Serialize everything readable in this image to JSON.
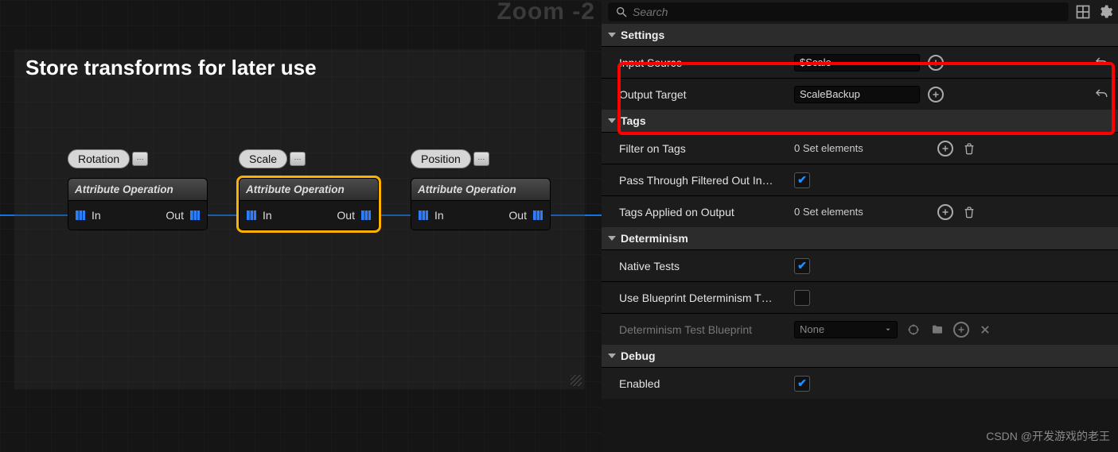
{
  "graph": {
    "zoom_label": "Zoom -2",
    "comment_title": "Store transforms for later use",
    "nodes": [
      {
        "tag": "Rotation",
        "title": "Attribute Operation",
        "in": "In",
        "out": "Out"
      },
      {
        "tag": "Scale",
        "title": "Attribute Operation",
        "in": "In",
        "out": "Out"
      },
      {
        "tag": "Position",
        "title": "Attribute Operation",
        "in": "In",
        "out": "Out"
      }
    ]
  },
  "search": {
    "placeholder": "Search"
  },
  "sections": {
    "settings": {
      "title": "Settings",
      "input_source": {
        "label": "Input Source",
        "value": "$Scale"
      },
      "output_target": {
        "label": "Output Target",
        "value": "ScaleBackup"
      }
    },
    "tags": {
      "title": "Tags",
      "filter": {
        "label": "Filter on Tags",
        "value": "0 Set elements"
      },
      "passthrough": {
        "label": "Pass Through Filtered Out In…",
        "checked": true
      },
      "applied": {
        "label": "Tags Applied on Output",
        "value": "0 Set elements"
      }
    },
    "determinism": {
      "title": "Determinism",
      "native": {
        "label": "Native Tests",
        "checked": true
      },
      "usebp": {
        "label": "Use Blueprint Determinism T…",
        "checked": false
      },
      "bp": {
        "label": "Determinism Test Blueprint",
        "value": "None"
      }
    },
    "debug": {
      "title": "Debug",
      "enabled": {
        "label": "Enabled",
        "checked": true
      }
    }
  },
  "watermark": "CSDN @开发游戏的老王"
}
